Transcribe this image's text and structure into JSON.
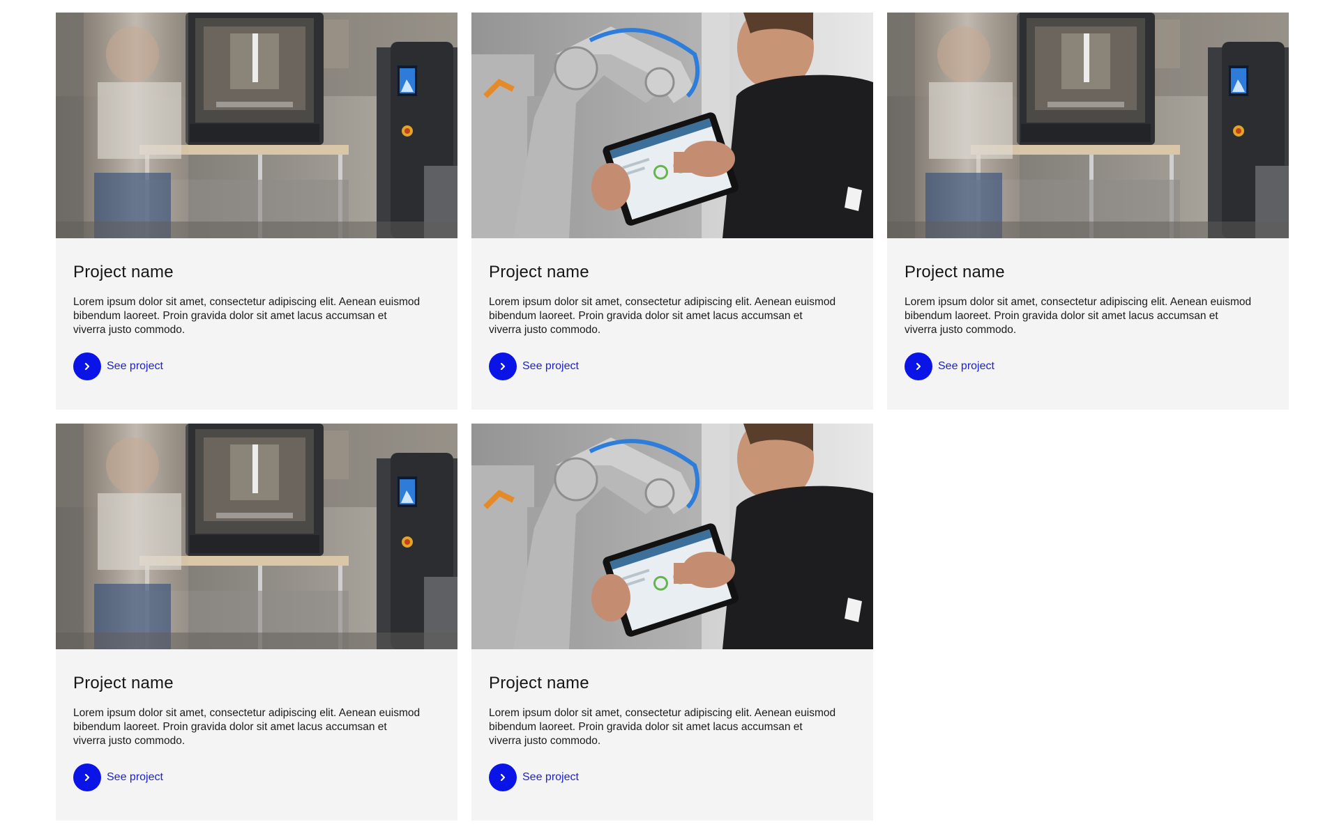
{
  "colors": {
    "accent": "#0a14e6",
    "card_background": "#f4f4f4",
    "link_text": "#1a1fd6"
  },
  "cards": [
    {
      "image": "3d-printer-photo",
      "title": "Project name",
      "description": "Lorem ipsum dolor sit amet, consectetur adipiscing elit. Aenean euismod bibendum laoreet. Proin gravida dolor sit amet lacus accumsan et viverra justo commodo.",
      "link_label": "See project",
      "link_icon": "chevron-right-icon"
    },
    {
      "image": "robot-arm-tablet-photo",
      "title": "Project name",
      "description": "Lorem ipsum dolor sit amet, consectetur adipiscing elit. Aenean euismod bibendum laoreet. Proin gravida dolor sit amet lacus accumsan et viverra justo commodo.",
      "link_label": "See project",
      "link_icon": "chevron-right-icon"
    },
    {
      "image": "3d-printer-photo",
      "title": "Project name",
      "description": "Lorem ipsum dolor sit amet, consectetur adipiscing elit. Aenean euismod bibendum laoreet. Proin gravida dolor sit amet lacus accumsan et viverra justo commodo.",
      "link_label": "See project",
      "link_icon": "chevron-right-icon"
    },
    {
      "image": "3d-printer-photo",
      "title": "Project name",
      "description": "Lorem ipsum dolor sit amet, consectetur adipiscing elit. Aenean euismod bibendum laoreet. Proin gravida dolor sit amet lacus accumsan et viverra justo commodo.",
      "link_label": "See project",
      "link_icon": "chevron-right-icon"
    },
    {
      "image": "robot-arm-tablet-photo",
      "title": "Project name",
      "description": "Lorem ipsum dolor sit amet, consectetur adipiscing elit. Aenean euismod bibendum laoreet. Proin gravida dolor sit amet lacus accumsan et viverra justo commodo.",
      "link_label": "See project",
      "link_icon": "chevron-right-icon"
    }
  ]
}
